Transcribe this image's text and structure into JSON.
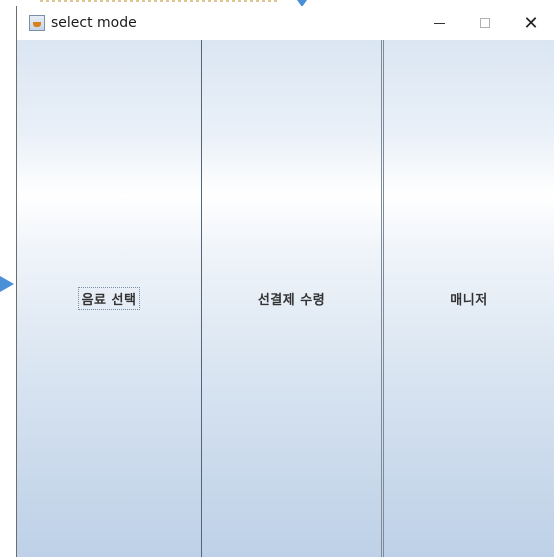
{
  "window": {
    "title": "select mode"
  },
  "buttons": [
    {
      "label": "음료 선택",
      "focused": true
    },
    {
      "label": "선결제 수령",
      "focused": false
    },
    {
      "label": "매니저",
      "focused": false
    }
  ],
  "controls": {
    "close_glyph": "✕"
  },
  "icons": {
    "app": "java-app-icon",
    "minimize": "minimize-icon",
    "maximize": "maximize-icon",
    "close": "close-icon"
  }
}
